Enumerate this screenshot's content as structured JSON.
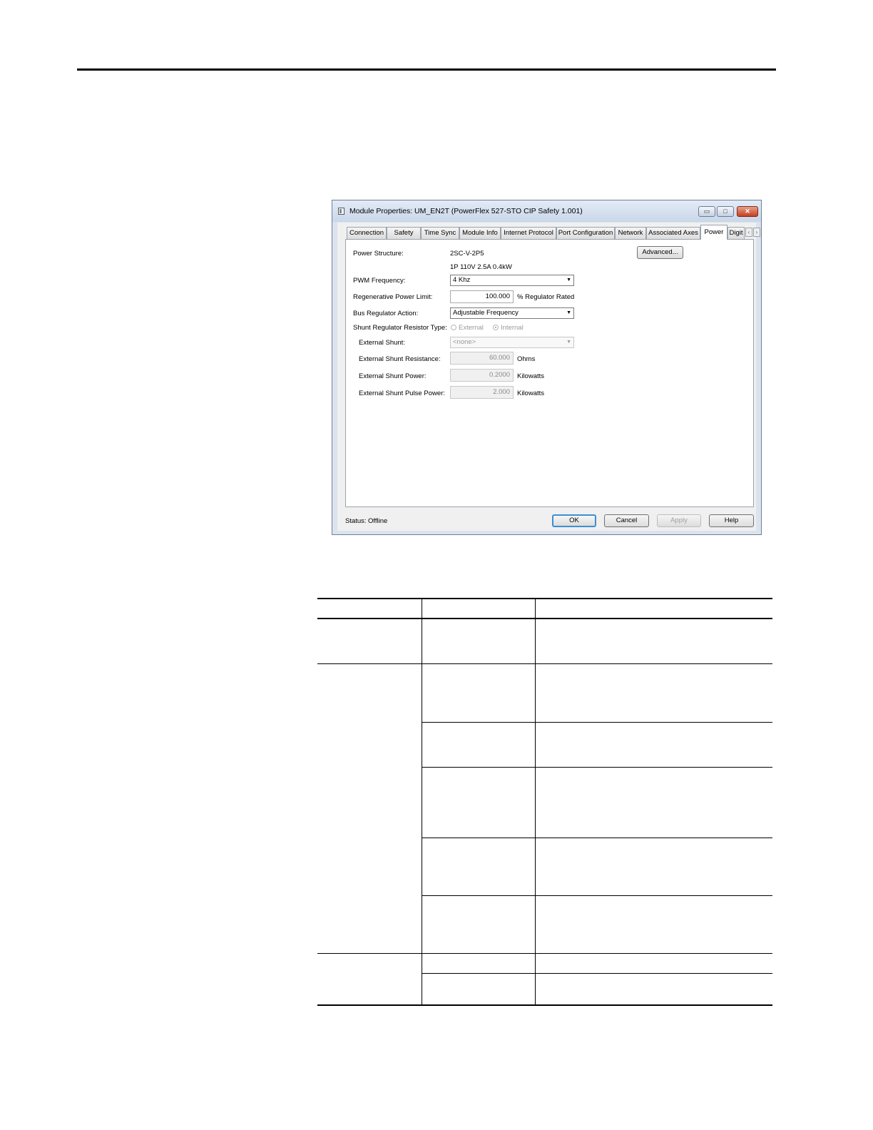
{
  "dialog": {
    "title": "Module Properties: UM_EN2T (PowerFlex 527-STO CIP Safety 1.001)",
    "window_buttons": {
      "minimize": "▭",
      "maximize": "□",
      "close": "✕"
    },
    "tabs": [
      "Connection",
      "Safety",
      "Time Sync",
      "Module Info",
      "Internet Protocol",
      "Port Configuration",
      "Network",
      "Associated Axes",
      "Power",
      "Digit"
    ],
    "active_tab": "Power",
    "tab_scroll": {
      "left": "‹",
      "right": "›"
    },
    "power": {
      "power_structure_label": "Power Structure:",
      "power_structure_value": "2SC-V-2P5",
      "power_structure_detail": "1P 110V  2.5A  0.4kW",
      "advanced_button": "Advanced...",
      "pwm_label": "PWM Frequency:",
      "pwm_value": "4 Khz",
      "regen_label": "Regenerative Power Limit:",
      "regen_value": "100.000",
      "regen_unit": "% Regulator Rated",
      "bus_reg_label": "Bus Regulator Action:",
      "bus_reg_value": "Adjustable Frequency",
      "shunt_type_label": "Shunt Regulator Resistor Type:",
      "shunt_type_options": [
        "External",
        "Internal"
      ],
      "shunt_type_selected": "Internal",
      "ext_shunt_label": "External Shunt:",
      "ext_shunt_value": "<none>",
      "ext_res_label": "External Shunt Resistance:",
      "ext_res_value": "60.000",
      "ext_res_unit": "Ohms",
      "ext_power_label": "External Shunt Power:",
      "ext_power_value": "0.2000",
      "ext_power_unit": "Kilowatts",
      "ext_pulse_label": "External Shunt Pulse Power:",
      "ext_pulse_value": "2.000",
      "ext_pulse_unit": "Kilowatts"
    },
    "status_label": "Status:",
    "status_value": "Offline",
    "buttons": {
      "ok": "OK",
      "cancel": "Cancel",
      "apply": "Apply",
      "help": "Help"
    }
  },
  "table": {
    "header": [
      "",
      "",
      ""
    ],
    "rows": 9
  }
}
